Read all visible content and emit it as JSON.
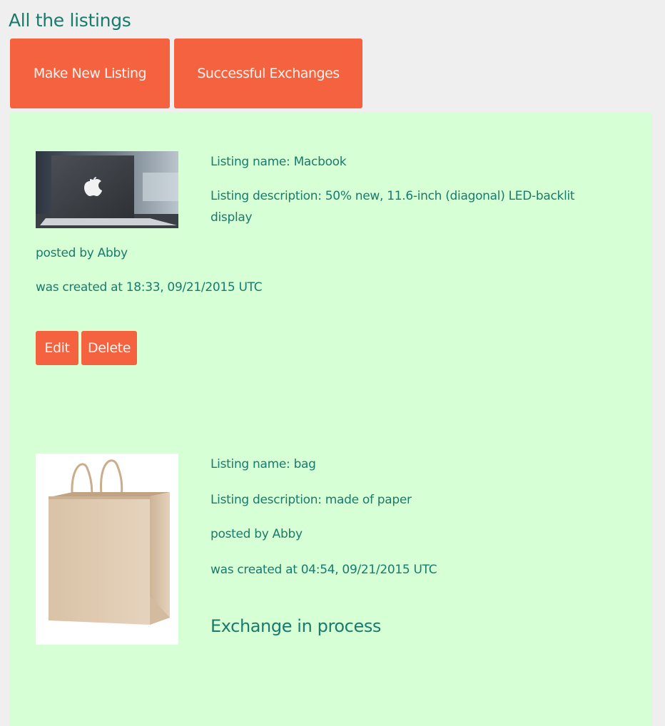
{
  "page": {
    "title": "All the listings"
  },
  "toolbar": {
    "new_listing_label": "Make New Listing",
    "exchanges_label": "Successful Exchanges"
  },
  "listings": [
    {
      "name_label": "Listing name:",
      "name": "Macbook",
      "desc_label": "Listing description:",
      "description": "50% new, 11.6-inch (diagonal) LED-backlit display",
      "posted_by_label": "posted by",
      "posted_by": "Abby",
      "created_label": "was created at",
      "created_at": "18:33, 09/21/2015 UTC",
      "edit_label": "Edit",
      "delete_label": "Delete",
      "image": "laptop-photo"
    },
    {
      "name_label": "Listing name:",
      "name": "bag",
      "desc_label": "Listing description:",
      "description": "made of paper",
      "posted_by_label": "posted by",
      "posted_by": "Abby",
      "created_label": "was created at",
      "created_at": "04:54, 09/21/2015 UTC",
      "status": "Exchange in process",
      "image": "paper-bag-photo"
    }
  ],
  "colors": {
    "background": "#efefef",
    "panel": "#d7ffd6",
    "accent_button": "#f5623f",
    "text": "#1a7a6c"
  }
}
